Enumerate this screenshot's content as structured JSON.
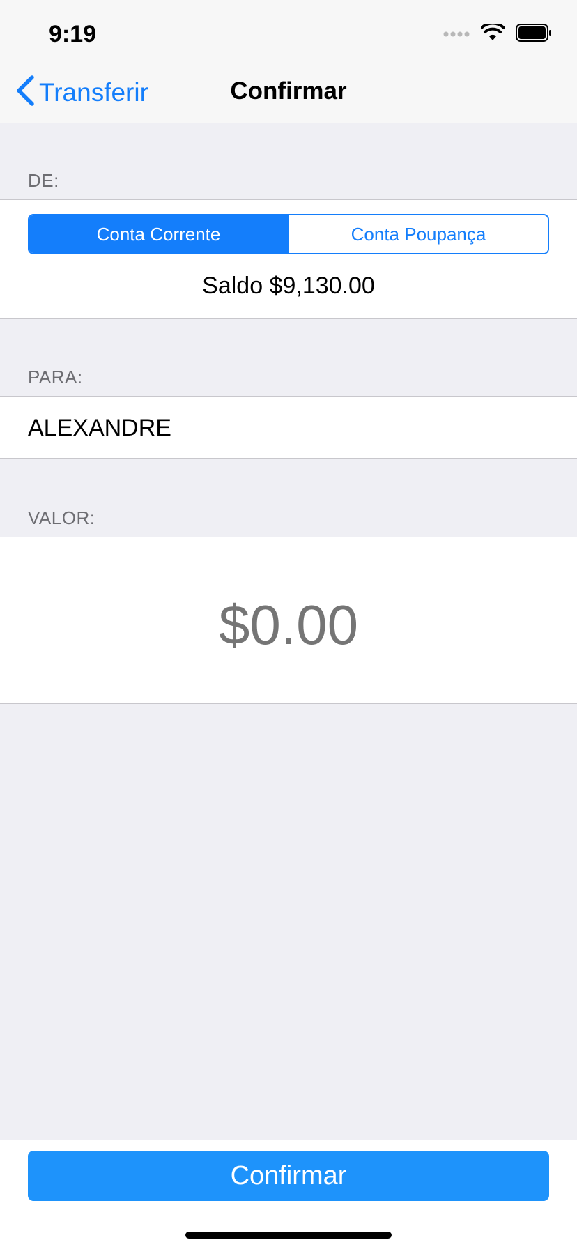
{
  "status_bar": {
    "time": "9:19",
    "icons": [
      "signal-dots-icon",
      "wifi-icon",
      "battery-icon"
    ]
  },
  "nav": {
    "back_label": "Transferir",
    "title": "Confirmar"
  },
  "sections": {
    "from_header": "DE:",
    "to_header": "PARA:",
    "amount_header": "VALOR:"
  },
  "account_selector": {
    "options": [
      "Conta Corrente",
      "Conta Poupança"
    ],
    "selected_index": 0
  },
  "balance_text": "Saldo $9,130.00",
  "recipient_name": "ALEXANDRE",
  "amount": {
    "placeholder": "$0.00"
  },
  "footer": {
    "confirm_label": "Confirmar"
  },
  "colors": {
    "accent": "#147EFB",
    "confirm_button": "#1E93FB",
    "background": "#EFEFF4",
    "placeholder": "#C7C7CD",
    "section_header": "#6D6D72"
  }
}
